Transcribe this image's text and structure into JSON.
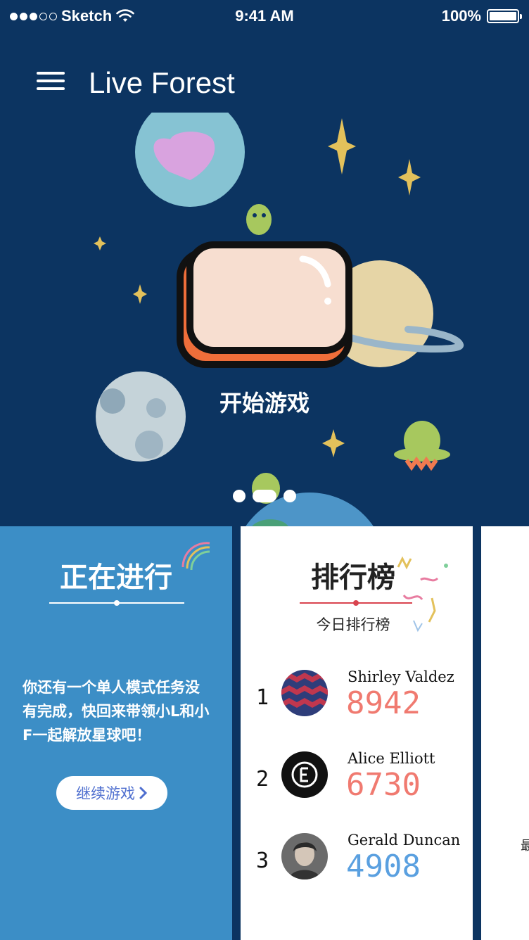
{
  "status": {
    "carrier": "Sketch",
    "time": "9:41 AM",
    "battery": "100%"
  },
  "header": {
    "title": "Live Forest"
  },
  "hero": {
    "start_label": "开始游戏",
    "pages": 3,
    "active_page": 1
  },
  "ongoing": {
    "title": "正在进行",
    "message": "你还有一个单人模式任务没有完成，快回来带领小L和小F一起解放星球吧！",
    "button_label": "继续游戏",
    "button_icon": "chevron-right-icon"
  },
  "leaderboard": {
    "title": "排行榜",
    "subtitle": "今日排行榜",
    "rows": [
      {
        "rank": "1",
        "name": "Shirley Valdez",
        "score": "8942",
        "score_color": "#f07a70"
      },
      {
        "rank": "2",
        "name": "Alice Elliott",
        "score": "6730",
        "score_color": "#f07a70"
      },
      {
        "rank": "3",
        "name": "Gerald Duncan",
        "score": "4908",
        "score_color": "#5aa0e0"
      }
    ]
  },
  "third_card": {
    "glyph": "最"
  },
  "colors": {
    "background": "#0c3461",
    "ongoing_card": "#3c8ec6",
    "accent_red": "#d9444f",
    "button_text": "#4f6fcf"
  }
}
